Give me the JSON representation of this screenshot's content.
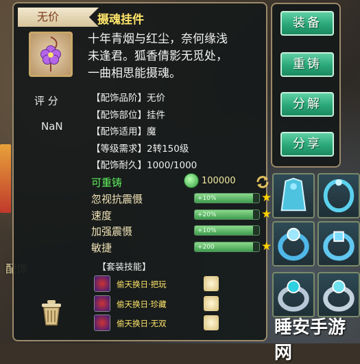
{
  "background": {
    "left_label": "配饰"
  },
  "tooltip": {
    "rank": "无价",
    "name": "摄魂挂件",
    "description_lines": [
      "十年青烟与红尘，奈何缘浅",
      "未逢君。狐香倩影无觅处，",
      "一曲相思能摄魂。"
    ],
    "score_label": "评 分",
    "score_value": "NaN",
    "attributes": [
      "【配饰品阶】无价",
      "【配饰部位】挂件",
      "【配饰适用】魔",
      "【等级需求】2转150级",
      "【配饰耐久】1000/1000"
    ],
    "recast_label": "可重铸",
    "recast_cost": "100000",
    "stats": [
      {
        "name": "忽视抗震慑",
        "value": "+10%",
        "fill": 0.9,
        "star": true
      },
      {
        "name": "速度",
        "value": "+20%",
        "fill": 0.9,
        "star": true
      },
      {
        "name": "加强震慑",
        "value": "+10%",
        "fill": 0.9,
        "star": false
      },
      {
        "name": "敏捷",
        "value": "+200",
        "fill": 0.9,
        "star": true
      }
    ],
    "set_title": "【套装技能】",
    "set_skills": [
      "偷天换日·把玩",
      "偷天换日·珍藏",
      "偷天换日·无双"
    ]
  },
  "actions": {
    "equip": "装备",
    "recast": "重铸",
    "decompose": "分解",
    "share": "分享"
  },
  "watermark": "睡安手游网",
  "colors": {
    "rank_text": "#7a3b1c",
    "title": "#ffe56a",
    "recast": "#5ef05e",
    "button": "#2aa77a",
    "star": "#ffd200"
  }
}
